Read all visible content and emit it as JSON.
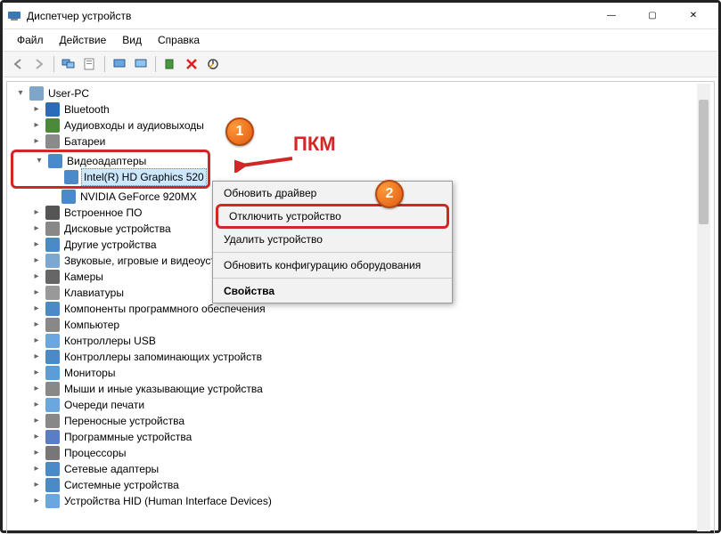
{
  "window": {
    "title": "Диспетчер устройств"
  },
  "menu": {
    "file": "Файл",
    "action": "Действие",
    "view": "Вид",
    "help": "Справка"
  },
  "tree": {
    "root": "User-PC",
    "items": [
      {
        "label": "Bluetooth"
      },
      {
        "label": "Аудиовходы и аудиовыходы"
      },
      {
        "label": "Батареи"
      },
      {
        "label": "Видеоадаптеры",
        "expanded": true,
        "children": [
          {
            "label": "Intel(R) HD Graphics 520",
            "highlighted": true
          },
          {
            "label": "NVIDIA GeForce 920MX"
          }
        ]
      },
      {
        "label": "Встроенное ПО"
      },
      {
        "label": "Дисковые устройства"
      },
      {
        "label": "Другие устройства"
      },
      {
        "label": "Звуковые, игровые и видеоустройства"
      },
      {
        "label": "Камеры"
      },
      {
        "label": "Клавиатуры"
      },
      {
        "label": "Компоненты программного обеспечения"
      },
      {
        "label": "Компьютер"
      },
      {
        "label": "Контроллеры USB"
      },
      {
        "label": "Контроллеры запоминающих устройств"
      },
      {
        "label": "Мониторы"
      },
      {
        "label": "Мыши и иные указывающие устройства"
      },
      {
        "label": "Очереди печати"
      },
      {
        "label": "Переносные устройства"
      },
      {
        "label": "Программные устройства"
      },
      {
        "label": "Процессоры"
      },
      {
        "label": "Сетевые адаптеры"
      },
      {
        "label": "Системные устройства"
      },
      {
        "label": "Устройства HID (Human Interface Devices)"
      }
    ]
  },
  "context_menu": {
    "update": "Обновить драйвер",
    "disable": "Отключить устройство",
    "remove": "Удалить устройство",
    "refresh": "Обновить конфигурацию оборудования",
    "properties": "Свойства"
  },
  "annotations": {
    "pkm": "ПКМ",
    "badge1": "1",
    "badge2": "2"
  }
}
